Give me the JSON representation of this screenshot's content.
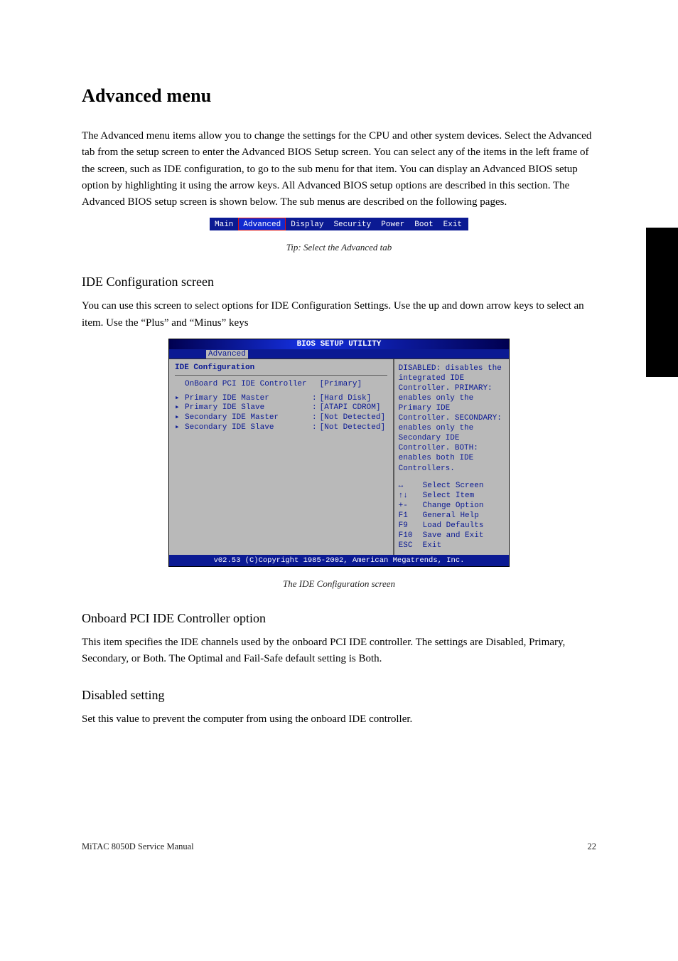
{
  "title": "Advanced menu",
  "intro": "The Advanced menu items allow you to change the settings for the CPU and other system devices. Select the Advanced tab from the setup screen to enter the Advanced BIOS Setup screen. You can select any of the items in the left frame of the screen, such as IDE configuration, to go to the sub menu for that item. You can display an Advanced BIOS setup option by highlighting it using the arrow keys. All Advanced BIOS setup options are described in this section. The Advanced BIOS setup screen is shown below. The sub menus are described on the following pages.",
  "bios_tabs": [
    "Main",
    "Advanced",
    "Display",
    "Security",
    "Power",
    "Boot",
    "Exit"
  ],
  "caption_tip": "Tip: Select the Advanced tab",
  "ide_heading": "IDE Configuration screen",
  "ide_para": "You can use this screen to select options for IDE Configuration Settings. Use the up and down arrow keys to select an item. Use the “Plus” and “Minus” keys",
  "bios": {
    "title": "BIOS SETUP UTILITY",
    "tab": "Advanced",
    "section": "IDE Configuration",
    "rows": [
      {
        "arrow": "",
        "label": "OnBoard PCI IDE Controller",
        "val": "[Primary]"
      },
      {
        "arrow": "▸",
        "label": "Primary IDE Master",
        "val": "[Hard Disk]"
      },
      {
        "arrow": "▸",
        "label": "Primary IDE Slave",
        "val": "[ATAPI CDROM]"
      },
      {
        "arrow": "▸",
        "label": "Secondary IDE Master",
        "val": "[Not Detected]"
      },
      {
        "arrow": "▸",
        "label": "Secondary IDE Slave",
        "val": "[Not Detected]"
      }
    ],
    "help_text": "DISABLED: disables the integrated IDE Controller.  PRIMARY: enables only the Primary IDE Controller.  SECONDARY: enables only the Secondary IDE Controller.  BOTH: enables both IDE Controllers.",
    "keys": [
      {
        "k": "↔",
        "d": "Select Screen"
      },
      {
        "k": "↑↓",
        "d": "Select Item"
      },
      {
        "k": "+-",
        "d": "Change Option"
      },
      {
        "k": "F1",
        "d": "General Help"
      },
      {
        "k": "F9",
        "d": "Load Defaults"
      },
      {
        "k": "F10",
        "d": "Save and Exit"
      },
      {
        "k": "ESC",
        "d": "Exit"
      }
    ],
    "footer": "v02.53 (C)Copyright 1985-2002, American Megatrends, Inc."
  },
  "caption_ide": "The IDE Configuration screen",
  "opt_heading": "Onboard PCI IDE Controller option",
  "opt_para1": "This item specifies the IDE channels used by the onboard PCI IDE controller. The settings are Disabled, Primary, Secondary, or Both. The Optimal and Fail-Safe default setting is Both.",
  "opt_heading2": "Disabled setting",
  "opt_para2": "Set this value to prevent the computer from using the onboard IDE controller.",
  "footer_left": "MiTAC 8050D Service Manual",
  "footer_right": "22"
}
